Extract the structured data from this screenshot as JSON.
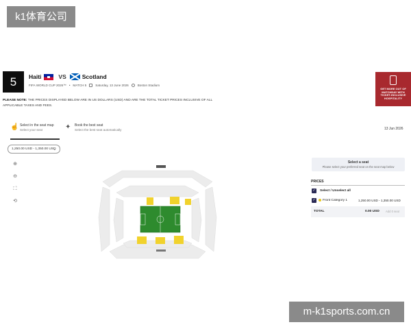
{
  "watermarks": {
    "top": "k1体育公司",
    "bottom": "m-k1sports.com.cn"
  },
  "match": {
    "number": "5",
    "team_home": "Haiti",
    "vs": "VS",
    "team_away": "Scotland",
    "competition": "FIFA WORLD CUP 2026™",
    "match_label": "MATCH 5",
    "date": "Saturday, 13 June 2026",
    "venue": "Boston Stadium"
  },
  "notice": {
    "label": "PLEASE NOTE:",
    "text": "THE PRICES DISPLAYED BELOW ARE IN US DOLLARS (USD) AND ARE THE TOTAL TICKET PRICES INCLUSIVE OF ALL APPLICABLE TAXES AND FEES."
  },
  "promo": {
    "text": "GET MORE OUT OF MATCHDAY WITH TICKET-INCLUSIVE HOSPITALITY"
  },
  "modes": {
    "select_map_title": "Select in the seat map",
    "select_map_sub": "Select your seat",
    "best_seat_title": "Book the best seat",
    "best_seat_sub": "Select the best seat automatically"
  },
  "date_label": "13 Jun 2026",
  "price_filter": {
    "value": "1,250.00 USD - 1,350.00 USD"
  },
  "icons": {
    "zoom_in": "zoom-in-icon",
    "zoom_out": "zoom-out-icon",
    "fullscreen": "fullscreen-icon",
    "reset": "reset-view-icon"
  },
  "seat_panel": {
    "title": "Select a seat",
    "subtitle": "Please select your preferred seat on the seat map below"
  },
  "prices": {
    "heading": "PRICES",
    "select_all": "Select / Unselect all",
    "category": "Front Category 1",
    "range": "1,250.00 USD - 1,350.00 USD"
  },
  "total": {
    "label": "TOTAL",
    "value": "0.00 USD",
    "button": "Add 0 seat"
  },
  "colors": {
    "pitch": "#2e8b2e",
    "available_section": "#f1d22c",
    "unavailable_section": "#e9e9e9",
    "checkbox": "#2a2a55",
    "promo_bg": "#a8292e"
  }
}
